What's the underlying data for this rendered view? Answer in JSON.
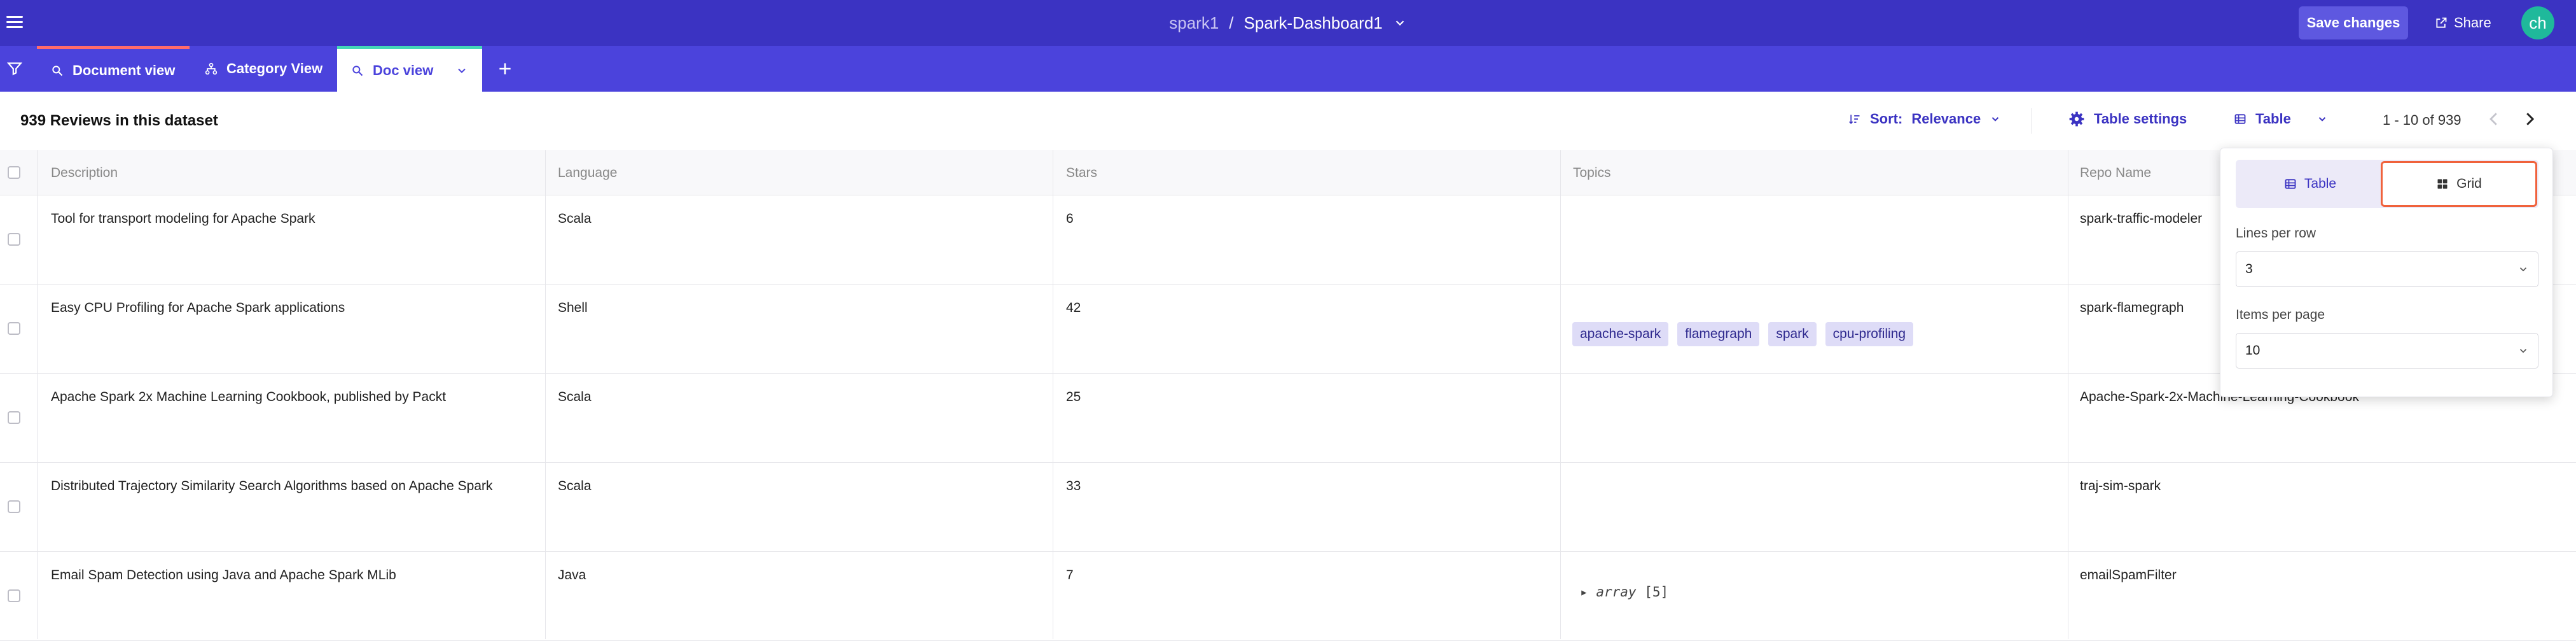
{
  "topbar": {
    "workspace": "spark1",
    "separator": "/",
    "dashboard": "Spark-Dashboard1",
    "save_label": "Save changes",
    "share_label": "Share",
    "avatar_initials": "ch"
  },
  "tabs": [
    {
      "label": "Document view",
      "icon": "search-icon",
      "active": false
    },
    {
      "label": "Category View",
      "icon": "hierarchy-icon",
      "active": false
    },
    {
      "label": "Doc view",
      "icon": "search-icon",
      "active": true
    }
  ],
  "toolbar": {
    "count_title": "939 Reviews in this dataset",
    "sort_label": "Sort:",
    "sort_value": "Relevance",
    "settings_label": "Table settings",
    "view_label": "Table",
    "pager_text": "1 - 10 of 939"
  },
  "table": {
    "columns": [
      "Description",
      "Language",
      "Stars",
      "Topics",
      "Repo Name"
    ],
    "rows": [
      {
        "description": "Tool for transport modeling for Apache Spark",
        "language": "Scala",
        "stars": "6",
        "topics": [],
        "repo": "spark-traffic-modeler"
      },
      {
        "description": "Easy CPU Profiling for Apache Spark applications",
        "language": "Shell",
        "stars": "42",
        "topics": [
          "apache-spark",
          "flamegraph",
          "spark",
          "cpu-profiling"
        ],
        "repo": "spark-flamegraph"
      },
      {
        "description": "Apache Spark 2x Machine Learning Cookbook, published by Packt",
        "language": "Scala",
        "stars": "25",
        "topics": [],
        "repo": "Apache-Spark-2x-Machine-Learning-Cookbook"
      },
      {
        "description": "Distributed Trajectory Similarity Search Algorithms based on Apache Spark",
        "language": "Scala",
        "stars": "33",
        "topics": [],
        "repo": "traj-sim-spark"
      },
      {
        "description": "Email Spam Detection using Java and Apache Spark MLib",
        "language": "Java",
        "stars": "7",
        "topics_array": {
          "toggle": "▸",
          "keyword": "array",
          "count": "[5]"
        },
        "repo": "emailSpamFilter"
      }
    ]
  },
  "popover": {
    "table_label": "Table",
    "grid_label": "Grid",
    "lines_label": "Lines per row",
    "lines_value": "3",
    "items_label": "Items per page",
    "items_value": "10"
  },
  "colors": {
    "topbar": "#3b33c2",
    "tabbar": "#4b43dc",
    "accent": "#3b33c2",
    "tag_bg": "#dedcf7",
    "avatar": "#1fb99b",
    "highlight": "#f0623c"
  }
}
